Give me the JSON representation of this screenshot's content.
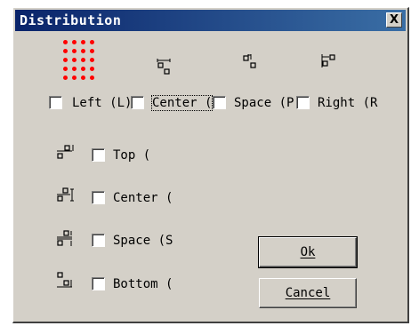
{
  "window": {
    "title": "Distribution",
    "close_glyph": "X"
  },
  "horizontal": {
    "options": [
      {
        "label": "Left (L)",
        "icon": "align-left-distribute-icon"
      },
      {
        "label": "Center (",
        "icon": "center-horizontal-distribute-icon"
      },
      {
        "label": "Space (P",
        "icon": "space-horizontal-distribute-icon"
      },
      {
        "label": "Right (R",
        "icon": "align-right-distribute-icon"
      }
    ]
  },
  "vertical": {
    "options": [
      {
        "label": "Top (",
        "icon": "align-top-distribute-icon"
      },
      {
        "label": "Center (",
        "icon": "center-vertical-distribute-icon"
      },
      {
        "label": "Space (S",
        "icon": "space-vertical-distribute-icon"
      },
      {
        "label": "Bottom (",
        "icon": "align-bottom-distribute-icon"
      }
    ]
  },
  "buttons": {
    "ok": "Ok",
    "cancel": "Cancel"
  },
  "colors": {
    "title_bar_start": "#0a246a",
    "title_bar_end": "#3a6ea5",
    "dialog_face": "#d4d0c8",
    "dot_grid": "#ff0000"
  }
}
